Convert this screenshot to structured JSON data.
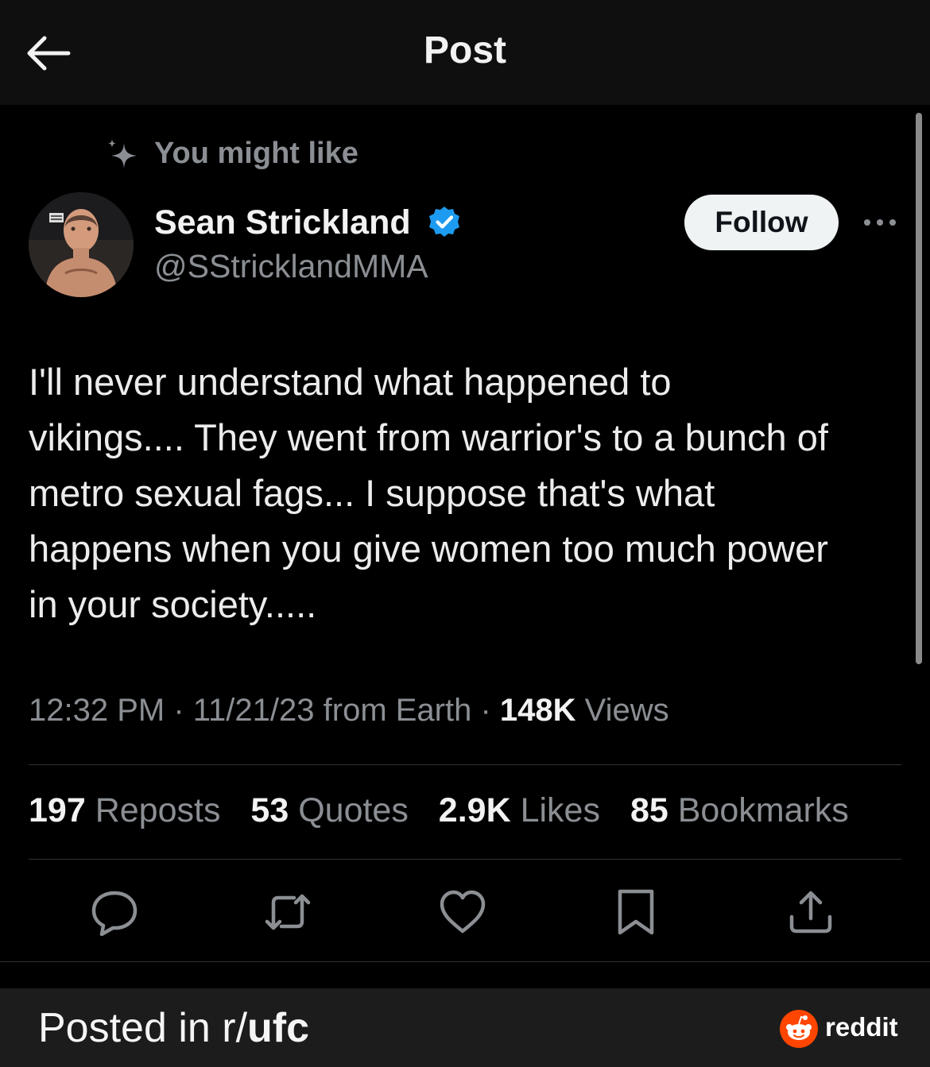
{
  "header": {
    "title": "Post"
  },
  "recommendation": {
    "label": "You might like"
  },
  "author": {
    "name": "Sean Strickland",
    "handle": "@SStricklandMMA",
    "verified": true,
    "follow_label": "Follow"
  },
  "post": {
    "lines": [
      "I'll never understand what happened to",
      "vikings.... They went from warrior's to a bunch of",
      "metro sexual fags... I suppose that's what",
      "happens when you give women too much power",
      "in your society....."
    ],
    "time": "12:32 PM",
    "date": "11/21/23",
    "source": "from Earth",
    "views_count": "148K",
    "views_label": "Views"
  },
  "stats": [
    {
      "value": "197",
      "label": "Reposts"
    },
    {
      "value": "53",
      "label": "Quotes"
    },
    {
      "value": "2.9K",
      "label": "Likes"
    },
    {
      "value": "85",
      "label": "Bookmarks"
    }
  ],
  "actions": [
    "reply-icon",
    "repost-icon",
    "like-icon",
    "bookmark-icon",
    "share-icon"
  ],
  "footer": {
    "caption_prefix": "Posted in r/",
    "subreddit": "ufc",
    "brand": "reddit"
  },
  "colors": {
    "background": "#000000",
    "muted_text": "#8b8f94",
    "verified": "#1d9bf0",
    "reddit_orange": "#ff4500"
  }
}
